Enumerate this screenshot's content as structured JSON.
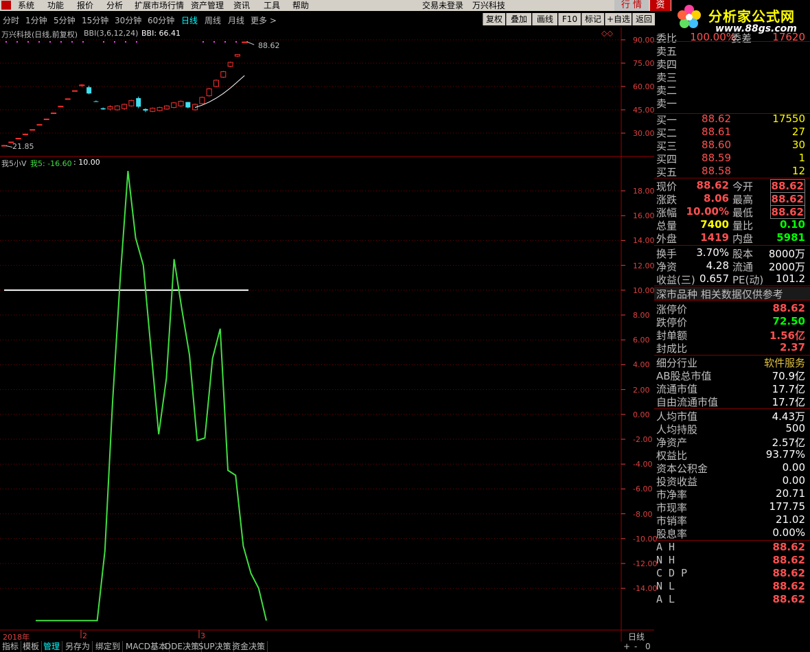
{
  "menu": {
    "items": [
      "系统",
      "功能",
      "报价",
      "分析",
      "扩展市场行情",
      "资产管理",
      "资讯",
      "工具",
      "帮助"
    ],
    "login_status": "交易未登录",
    "stock_name": "万兴科技",
    "quote_btn": "行 情",
    "asset_btn": "资"
  },
  "brand": {
    "name": "分析家公式网",
    "url": "www.88gs.com"
  },
  "periods": {
    "items": [
      "分时",
      "1分钟",
      "5分钟",
      "15分钟",
      "30分钟",
      "60分钟",
      "日线",
      "周线",
      "月线",
      "更多 >"
    ],
    "active_index": 6
  },
  "toolbar": {
    "items": [
      "复权",
      "叠加",
      "画线",
      "F10",
      "标记",
      "+自选",
      "返回"
    ]
  },
  "main_chart": {
    "title": "万兴科技(日线,前复权)",
    "indicator": "BBI(3,6,12,24)",
    "indicator_value": "BBI: 66.41",
    "high_label": "88.62",
    "low_label": "21.85",
    "yticks": [
      "90.00",
      "75.00",
      "60.00",
      "45.00",
      "30.00"
    ]
  },
  "sub_chart": {
    "name": "我5小V",
    "series_label": "我5: -16.60",
    "ref_value": ": 10.00",
    "yticks": [
      "18.00",
      "16.00",
      "14.00",
      "12.00",
      "10.00",
      "8.00",
      "6.00",
      "4.00",
      "2.00",
      "0.00",
      "-2.00",
      "-4.00",
      "-6.00",
      "-8.00",
      "-10.00",
      "-12.00",
      "-14.00"
    ]
  },
  "xaxis": {
    "labels": [
      "2018年",
      "2",
      "3"
    ],
    "period_label": "日线"
  },
  "bottom_tabs": [
    "指标",
    "模板",
    "管理",
    "另存为",
    "绑定到",
    "MACD基本",
    "DDE决策",
    "SUP决策",
    "资金决策"
  ],
  "bottom_right": [
    "+",
    "-",
    "0"
  ],
  "order_book": {
    "weibi_label": "委比",
    "weibi_value": "100.00%",
    "weicha_label": "委差",
    "weicha_value": "17620",
    "sells": [
      {
        "label": "卖五",
        "price": "",
        "vol": ""
      },
      {
        "label": "卖四",
        "price": "",
        "vol": ""
      },
      {
        "label": "卖三",
        "price": "",
        "vol": ""
      },
      {
        "label": "卖二",
        "price": "",
        "vol": ""
      },
      {
        "label": "卖一",
        "price": "",
        "vol": ""
      }
    ],
    "buys": [
      {
        "label": "买一",
        "price": "88.62",
        "vol": "17550"
      },
      {
        "label": "买二",
        "price": "88.61",
        "vol": "27"
      },
      {
        "label": "买三",
        "price": "88.60",
        "vol": "30"
      },
      {
        "label": "买四",
        "price": "88.59",
        "vol": "1"
      },
      {
        "label": "买五",
        "price": "88.58",
        "vol": "12"
      }
    ]
  },
  "quote": [
    {
      "l1": "现价",
      "v1": "88.62",
      "l2": "今开",
      "v2": "88.62"
    },
    {
      "l1": "涨跌",
      "v1": "8.06",
      "l2": "最高",
      "v2": "88.62"
    },
    {
      "l1": "涨幅",
      "v1": "10.00%",
      "l2": "最低",
      "v2": "88.62"
    },
    {
      "l1": "总量",
      "v1": "7400",
      "l2": "量比",
      "v2": "0.10"
    },
    {
      "l1": "外盘",
      "v1": "1419",
      "l2": "内盘",
      "v2": "5981"
    }
  ],
  "stats": [
    {
      "l1": "换手",
      "v1": "3.70%",
      "l2": "股本",
      "v2": "8000万"
    },
    {
      "l1": "净资",
      "v1": "4.28",
      "l2": "流通",
      "v2": "2000万"
    },
    {
      "l1": "收益(三)",
      "v1": "0.657",
      "l2": "PE(动)",
      "v2": "101.2"
    }
  ],
  "market_note": "深市品种  相关数据仅供参考",
  "limits": [
    {
      "label": "涨停价",
      "value": "88.62"
    },
    {
      "label": "跌停价",
      "value": "72.50"
    },
    {
      "label": "封单额",
      "value": "1.56亿"
    },
    {
      "label": "封成比",
      "value": "2.37"
    }
  ],
  "industry": {
    "label": "细分行业",
    "value": "软件服务"
  },
  "caps": [
    {
      "label": "AB股总市值",
      "value": "70.9亿"
    },
    {
      "label": "流通市值",
      "value": "17.7亿"
    },
    {
      "label": "自由流通市值",
      "value": "17.7亿"
    }
  ],
  "fundamentals": [
    {
      "label": "人均市值",
      "value": "4.43万"
    },
    {
      "label": "人均持股",
      "value": "500"
    },
    {
      "label": "净资产",
      "value": "2.57亿"
    },
    {
      "label": "权益比",
      "value": "93.77%"
    },
    {
      "label": "资本公积金",
      "value": "0.00"
    },
    {
      "label": "投资收益",
      "value": "0.00"
    },
    {
      "label": "市净率",
      "value": "20.71"
    },
    {
      "label": "市现率",
      "value": "177.75"
    },
    {
      "label": "市销率",
      "value": "21.02"
    },
    {
      "label": "股息率",
      "value": "0.00%"
    }
  ],
  "pivots": [
    {
      "label": "A H",
      "value": "88.62"
    },
    {
      "label": "N H",
      "value": "88.62"
    },
    {
      "label": "C D P",
      "value": "88.62"
    },
    {
      "label": "N L",
      "value": "88.62"
    },
    {
      "label": "A L",
      "value": "88.62"
    }
  ],
  "colors": {
    "up": "#ff3030",
    "down": "#40e0f0",
    "indicator_line": "#40e040",
    "grid": "#800000",
    "ref_line": "#ffffff"
  },
  "chart_data": [
    {
      "type": "candlestick",
      "ylim": [
        20,
        95
      ],
      "candles": [
        {
          "o": 21.85,
          "h": 22.5,
          "l": 21.85,
          "c": 22.1
        },
        {
          "o": 24.3,
          "h": 24.3,
          "l": 24.3,
          "c": 24.3
        },
        {
          "o": 26.7,
          "h": 26.7,
          "l": 26.7,
          "c": 26.7
        },
        {
          "o": 29.4,
          "h": 29.4,
          "l": 29.4,
          "c": 29.4
        },
        {
          "o": 32.3,
          "h": 32.3,
          "l": 32.3,
          "c": 32.3
        },
        {
          "o": 35.6,
          "h": 35.6,
          "l": 35.6,
          "c": 35.6
        },
        {
          "o": 39.1,
          "h": 39.1,
          "l": 39.1,
          "c": 39.1
        },
        {
          "o": 43.0,
          "h": 43.0,
          "l": 43.0,
          "c": 43.0
        },
        {
          "o": 47.3,
          "h": 47.3,
          "l": 47.3,
          "c": 47.3
        },
        {
          "o": 52.1,
          "h": 52.1,
          "l": 52.1,
          "c": 52.1
        },
        {
          "o": 57.3,
          "h": 57.3,
          "l": 57.3,
          "c": 57.3
        },
        {
          "o": 60.5,
          "h": 61.5,
          "l": 59.8,
          "c": 61.0
        },
        {
          "o": 59.5,
          "h": 60.5,
          "l": 55.0,
          "c": 55.5
        },
        {
          "o": 50.5,
          "h": 51.0,
          "l": 50.0,
          "c": 50.3
        },
        {
          "o": 46.0,
          "h": 46.5,
          "l": 45.0,
          "c": 45.3
        },
        {
          "o": 45.5,
          "h": 48.0,
          "l": 44.5,
          "c": 47.0
        },
        {
          "o": 45.0,
          "h": 48.0,
          "l": 44.5,
          "c": 47.5
        },
        {
          "o": 45.8,
          "h": 49.0,
          "l": 45.0,
          "c": 48.5
        },
        {
          "o": 47.5,
          "h": 51.5,
          "l": 47.0,
          "c": 51.0
        },
        {
          "o": 52.5,
          "h": 53.5,
          "l": 46.0,
          "c": 47.0
        },
        {
          "o": 45.5,
          "h": 46.0,
          "l": 43.5,
          "c": 44.5
        },
        {
          "o": 44.0,
          "h": 46.5,
          "l": 43.5,
          "c": 46.0
        },
        {
          "o": 44.5,
          "h": 47.0,
          "l": 44.0,
          "c": 46.5
        },
        {
          "o": 45.5,
          "h": 48.0,
          "l": 45.0,
          "c": 47.5
        },
        {
          "o": 46.5,
          "h": 50.0,
          "l": 46.0,
          "c": 49.5
        },
        {
          "o": 47.5,
          "h": 51.0,
          "l": 47.0,
          "c": 50.5
        },
        {
          "o": 50.0,
          "h": 50.0,
          "l": 46.0,
          "c": 46.5
        },
        {
          "o": 45.0,
          "h": 49.0,
          "l": 44.5,
          "c": 48.5
        },
        {
          "o": 49.0,
          "h": 53.5,
          "l": 48.5,
          "c": 53.0
        },
        {
          "o": 54.0,
          "h": 59.0,
          "l": 53.5,
          "c": 58.5
        },
        {
          "o": 60.0,
          "h": 64.5,
          "l": 59.5,
          "c": 64.0
        },
        {
          "o": 66.0,
          "h": 70.0,
          "l": 65.5,
          "c": 69.5
        },
        {
          "o": 73.0,
          "h": 76.0,
          "l": 72.5,
          "c": 75.5
        },
        {
          "o": 79.5,
          "h": 80.5,
          "l": 79.0,
          "c": 80.5
        },
        {
          "o": 88.62,
          "h": 88.62,
          "l": 88.62,
          "c": 88.62
        }
      ],
      "bbi_line": [
        [
          27,
          46.5
        ],
        [
          28,
          48.0
        ],
        [
          29,
          50.0
        ],
        [
          30,
          52.5
        ],
        [
          31,
          55.5
        ],
        [
          32,
          59.0
        ],
        [
          33,
          63.0
        ],
        [
          34,
          67.0
        ]
      ]
    },
    {
      "type": "line",
      "ylim": [
        -16,
        20
      ],
      "reference": 10.0,
      "series": [
        {
          "values": [
            [
              0,
              -16.6
            ],
            [
              5,
              -16.6
            ],
            [
              6,
              -16.6
            ],
            [
              7,
              -16.6
            ],
            [
              8,
              -16.6
            ],
            [
              9,
              -11
            ],
            [
              10,
              1
            ],
            [
              11,
              11
            ],
            [
              12,
              19.6
            ],
            [
              13,
              14.2
            ],
            [
              14,
              12
            ],
            [
              15,
              5.2
            ],
            [
              16,
              -1.6
            ],
            [
              17,
              2.9
            ],
            [
              18,
              12.5
            ],
            [
              19,
              8.5
            ],
            [
              20,
              4.8
            ],
            [
              21,
              -2.1
            ],
            [
              22,
              -1.9
            ],
            [
              23,
              4.5
            ],
            [
              24,
              6.9
            ],
            [
              25,
              -4.5
            ],
            [
              26,
              -4.9
            ],
            [
              27,
              -10.6
            ],
            [
              28,
              -12.8
            ],
            [
              29,
              -14
            ],
            [
              30,
              -16.6
            ]
          ]
        }
      ]
    }
  ]
}
